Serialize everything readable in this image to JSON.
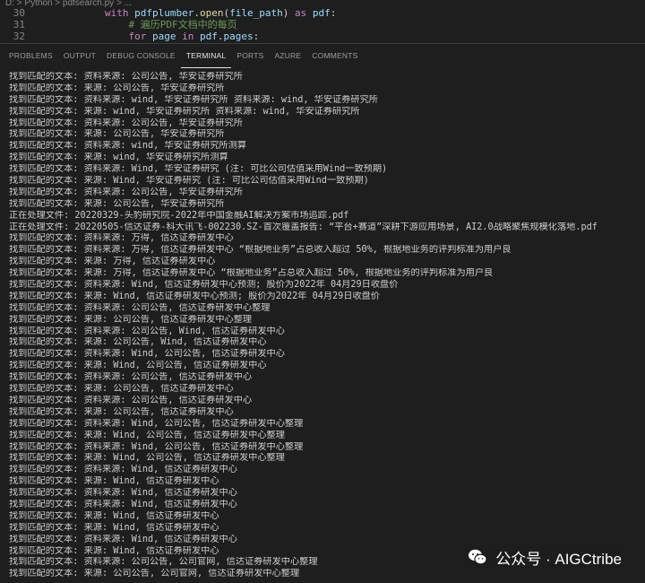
{
  "breadcrumb": "D: > Python > pdfsearch.py > ...",
  "editor": {
    "lines": [
      {
        "num": "30",
        "indent": "        ",
        "tokens": [
          [
            "kw",
            "with "
          ],
          [
            "var",
            "pdfplumber"
          ],
          [
            "pl",
            "."
          ],
          [
            "fn",
            "open"
          ],
          [
            "pl",
            "("
          ],
          [
            "var",
            "file_path"
          ],
          [
            "pl",
            ") "
          ],
          [
            "kw",
            "as "
          ],
          [
            "var",
            "pdf"
          ],
          [
            "pl",
            ":"
          ]
        ]
      },
      {
        "num": "31",
        "indent": "            ",
        "tokens": [
          [
            "cm",
            "# 遍历PDF文档中的每页"
          ]
        ]
      },
      {
        "num": "32",
        "indent": "            ",
        "tokens": [
          [
            "kw",
            "for "
          ],
          [
            "var",
            "page "
          ],
          [
            "kw",
            "in "
          ],
          [
            "var",
            "pdf"
          ],
          [
            "pl",
            "."
          ],
          [
            "var",
            "pages"
          ],
          [
            "pl",
            ":"
          ]
        ]
      }
    ]
  },
  "panel_tabs": [
    "PROBLEMS",
    "OUTPUT",
    "DEBUG CONSOLE",
    "TERMINAL",
    "PORTS",
    "AZURE",
    "COMMENTS"
  ],
  "active_tab": "TERMINAL",
  "terminal_lines": [
    "找到匹配的文本: 资料来源: 公司公告, 华安证券研究所",
    "找到匹配的文本: 来源: 公司公告, 华安证券研究所",
    "找到匹配的文本: 资料来源: wind, 华安证券研究所 资料来源: wind, 华安证券研究所",
    "找到匹配的文本: 来源: wind, 华安证券研究所 资料来源: wind, 华安证券研究所",
    "找到匹配的文本: 资料来源: 公司公告, 华安证券研究所",
    "找到匹配的文本: 来源: 公司公告, 华安证券研究所",
    "找到匹配的文本: 资料来源: wind, 华安证券研究所测算",
    "找到匹配的文本: 来源: wind, 华安证券研究所测算",
    "找到匹配的文本: 资料来源: Wind, 华安证券研究 (注: 可比公司估值采用Wind一致预期)",
    "找到匹配的文本: 来源: Wind, 华安证券研究 (注: 可比公司估值采用Wind一致预期)",
    "找到匹配的文本: 资料来源: 公司公告, 华安证券研究所",
    "找到匹配的文本: 来源: 公司公告, 华安证券研究所",
    "正在处理文件: 20220329-头豹研究院-2022年中国金融AI解决方案市场追踪.pdf",
    "正在处理文件: 20220505-信达证券-科大讯飞-002230.SZ-首次覆盖报告: “平台+赛道”深耕下游应用场景, AI2.0战略聚焦规模化落地.pdf",
    "找到匹配的文本: 资料来源: 万得, 信达证券研发中心",
    "找到匹配的文本: 资料来源: 万得, 信达证券研发中心 “根据地业务”占总收入超过 50%, 根据地业务的评判标准为用户良",
    "找到匹配的文本: 来源: 万得, 信达证券研发中心",
    "找到匹配的文本: 来源: 万得, 信达证券研发中心 “根据地业务”占总收入超过 50%, 根据地业务的评判标准为用户良",
    "找到匹配的文本: 资料来源: Wind, 信达证券研发中心预测; 股价为2022年 04月29日收盘价",
    "找到匹配的文本: 来源: Wind, 信达证券研发中心预测; 股价为2022年 04月29日收盘价",
    "找到匹配的文本: 资料来源: 公司公告, 信达证券研发中心整理",
    "找到匹配的文本: 来源: 公司公告, 信达证券研发中心整理",
    "找到匹配的文本: 资料来源: 公司公告, Wind, 信达证券研发中心",
    "找到匹配的文本: 来源: 公司公告, Wind, 信达证券研发中心",
    "找到匹配的文本: 资料来源: Wind, 公司公告, 信达证券研发中心",
    "找到匹配的文本: 来源: Wind, 公司公告, 信达证券研发中心",
    "找到匹配的文本: 资料来源: 公司公告, 信达证券研发中心",
    "找到匹配的文本: 来源: 公司公告, 信达证券研发中心",
    "找到匹配的文本: 资料来源: 公司公告, 信达证券研发中心",
    "找到匹配的文本: 来源: 公司公告, 信达证券研发中心",
    "找到匹配的文本: 资料来源: Wind, 公司公告, 信达证券研发中心整理",
    "找到匹配的文本: 来源: Wind, 公司公告, 信达证券研发中心整理",
    "找到匹配的文本: 资料来源: Wind, 公司公告, 信达证券研发中心整理",
    "找到匹配的文本: 来源: Wind, 公司公告, 信达证券研发中心整理",
    "找到匹配的文本: 资料来源: Wind, 信达证券研发中心",
    "找到匹配的文本: 来源: Wind, 信达证券研发中心",
    "找到匹配的文本: 资料来源: Wind, 信达证券研发中心",
    "找到匹配的文本: 资料来源: Wind, 信达证券研发中心",
    "找到匹配的文本: 来源: Wind, 信达证券研发中心",
    "找到匹配的文本: 来源: Wind, 信达证券研发中心",
    "找到匹配的文本: 资料来源: Wind, 信达证券研发中心",
    "找到匹配的文本: 来源: Wind, 信达证券研发中心",
    "找到匹配的文本: 资料来源: 公司公告, 公司官网, 信达证券研发中心整理",
    "找到匹配的文本: 来源: 公司公告, 公司官网, 信达证券研发中心整理"
  ],
  "watermark": {
    "text": "公众号 · AIGCtribe",
    "icon": "wechat-icon"
  }
}
